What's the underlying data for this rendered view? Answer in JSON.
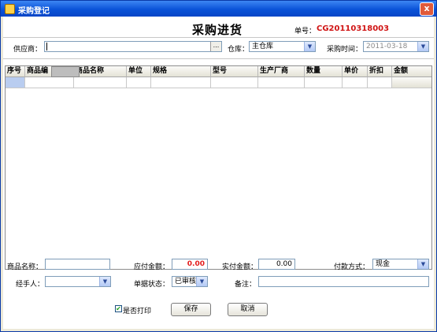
{
  "window": {
    "title": "采购登记",
    "close_glyph": "x"
  },
  "header": {
    "heading": "采购进货",
    "order_no_label": "单号：",
    "order_no": "CG20110318003"
  },
  "top_form": {
    "supplier_label": "供应商：",
    "supplier_value": "",
    "supplier_browse": "...",
    "warehouse_label": "仓库：",
    "warehouse_value": "主仓库",
    "purchase_time_label": "采购时间：",
    "purchase_time_value": "2011-03-18"
  },
  "grid": {
    "columns": [
      "序号",
      "商品编",
      "商品名称",
      "单位",
      "规格",
      "型号",
      "生产厂商",
      "数量",
      "单价",
      "折扣",
      "金额"
    ],
    "rows": [
      [
        "",
        "",
        "",
        "",
        "",
        "",
        "",
        "",
        "",
        "",
        ""
      ]
    ]
  },
  "bottom_form": {
    "product_name_label": "商品名称：",
    "product_name_value": "",
    "payable_label": "应付金额：",
    "payable_value": "0.00",
    "paid_label": "实付金额：",
    "paid_value": "0.00",
    "payment_method_label": "付款方式：",
    "payment_method_value": "现金",
    "handler_label": "经手人：",
    "handler_value": "",
    "status_label": "单据状态：",
    "status_value": "已审核",
    "remark_label": "备注：",
    "remark_value": ""
  },
  "footer": {
    "print_label": "是否打印",
    "print_checked": true,
    "save_label": "保存",
    "cancel_label": "取消"
  },
  "icons": {
    "dropdown": "chevron-down-icon",
    "check": "checkmark-icon",
    "browse": "ellipsis-icon"
  },
  "colors": {
    "titlebar": "#0a53d8",
    "order_no": "#d01414",
    "payable": "#e31b1b"
  }
}
